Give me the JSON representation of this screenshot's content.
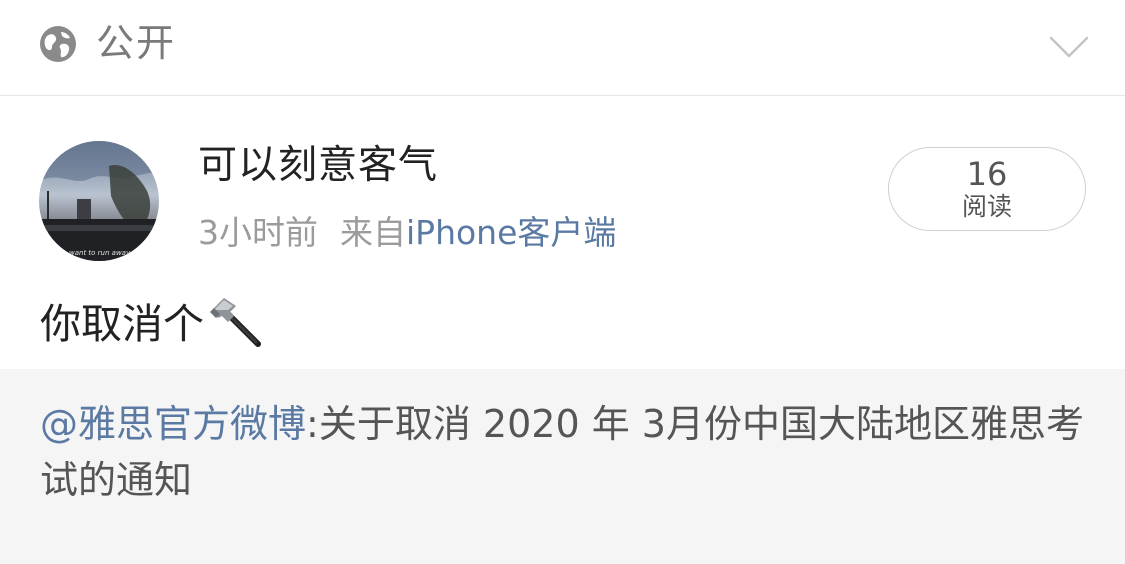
{
  "visibility": {
    "label": "公开",
    "icon": "globe-icon",
    "expand_icon": "chevron-down-icon"
  },
  "post": {
    "author": {
      "name": "可以刻意客气",
      "avatar_caption": "want to run away"
    },
    "time": "3小时前",
    "source_prefix": "来自",
    "source_name": "iPhone客户端",
    "read_count": "16",
    "read_label": "阅读",
    "text": "你取消个",
    "emoji": "hammer-icon"
  },
  "repost": {
    "mention": "@雅思官方微博",
    "separator": ":",
    "text": "关于取消 2020 年 3月份中国大陆地区雅思考试的通知"
  },
  "colors": {
    "link": "#5b7aa3",
    "muted": "#9b9b9b",
    "card_bg": "#f5f5f5"
  }
}
